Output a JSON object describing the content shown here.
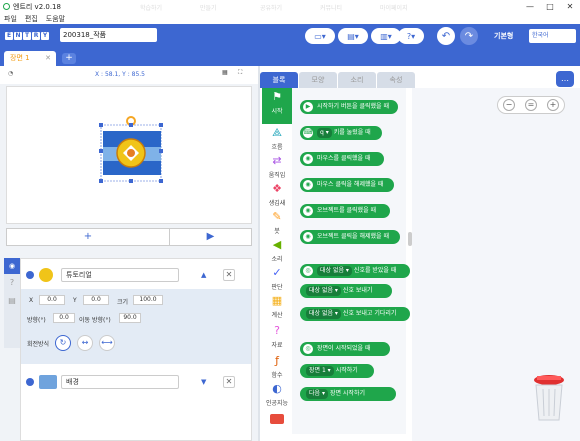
{
  "window": {
    "title": "엔트리 v2.0.18",
    "ghost_tabs": [
      "학습하기",
      "만들기",
      "공유하기",
      "커뮤니티",
      "마이페이지"
    ],
    "controls": [
      "—",
      "□",
      "✕"
    ]
  },
  "menu": {
    "items": [
      "파일",
      "편집",
      "도움말"
    ]
  },
  "toolbar": {
    "brand_letters": [
      "E",
      "N",
      "T",
      "R",
      "Y"
    ],
    "project_name": "200318_작품",
    "mode_label": "기본형",
    "language": "한국어",
    "colors": {
      "bar": "#3d67d1"
    }
  },
  "scene": {
    "tab_label": "장면 1",
    "close": "✕",
    "add": "+"
  },
  "stage": {
    "coords": "X : 58.1, Y : 85.5",
    "controls": {
      "add": "+",
      "play": "▶"
    }
  },
  "objects": [
    {
      "name": "튜토리얼",
      "arrow": "▲",
      "remove": "✕"
    },
    {
      "name": "배경",
      "arrow": "▼",
      "remove": "✕"
    }
  ],
  "properties": {
    "x_label": "X",
    "x_value": "0.0",
    "y_label": "Y",
    "y_value": "0.0",
    "size_label": "크기",
    "size_value": "100.0",
    "direction_label": "방향(°)",
    "direction_value": "0.0",
    "move_dir_label": "이동 방향(°)",
    "move_dir_value": "90.0",
    "rotation_label": "회전방식"
  },
  "tabs": [
    "블록",
    "모양",
    "소리",
    "속성"
  ],
  "categories": [
    {
      "label": "시작",
      "icon": "flag-icon",
      "glyph": "⚑"
    },
    {
      "label": "흐름",
      "icon": "flow-icon",
      "glyph": "⟁"
    },
    {
      "label": "움직임",
      "icon": "move-icon",
      "glyph": "⇄"
    },
    {
      "label": "생김새",
      "icon": "looks-icon",
      "glyph": "❖"
    },
    {
      "label": "붓",
      "icon": "brush-icon",
      "glyph": "✎"
    },
    {
      "label": "소리",
      "icon": "sound-icon",
      "glyph": "◀"
    },
    {
      "label": "판단",
      "icon": "judge-icon",
      "glyph": "✓"
    },
    {
      "label": "계산",
      "icon": "calc-icon",
      "glyph": "▦"
    },
    {
      "label": "자료",
      "icon": "data-icon",
      "glyph": "?"
    },
    {
      "label": "함수",
      "icon": "function-icon",
      "glyph": "ƒ"
    },
    {
      "label": "인공지능",
      "icon": "ai-icon",
      "glyph": "◐"
    }
  ],
  "blocks": [
    {
      "text": "시작하기 버튼을 클릭했을 때",
      "chip": "",
      "icon": "▶"
    },
    {
      "text": "키를 눌렀을 때",
      "chip": "q ▾",
      "icon": "⌨"
    },
    {
      "text": "마우스를 클릭했을 때",
      "chip": "",
      "icon": "◉"
    },
    {
      "text": "마우스 클릭을 해제했을 때",
      "chip": "",
      "icon": "◉"
    },
    {
      "text": "오브젝트를 클릭했을 때",
      "chip": "",
      "icon": "◉"
    },
    {
      "text": "오브젝트 클릭을 해제했을 때",
      "chip": "",
      "icon": "◉"
    },
    {
      "text": "신호를 받았을 때",
      "chip": "대상 없음 ▾",
      "icon": "◎"
    },
    {
      "text": "신호 보내기",
      "chip": "대상 없음 ▾",
      "icon": ""
    },
    {
      "text": "신호 보내고 기다리기",
      "chip": "대상 없음 ▾",
      "icon": ""
    },
    {
      "text": "장면이 시작되었을 때",
      "chip": "",
      "icon": "◎"
    },
    {
      "text": "시작하기",
      "chip": "장면 1 ▾",
      "icon": ""
    },
    {
      "text": "장면 시작하기",
      "chip": "다음 ▾",
      "icon": ""
    }
  ],
  "zoom": {
    "out": "−",
    "reset": "=",
    "in": "+"
  }
}
